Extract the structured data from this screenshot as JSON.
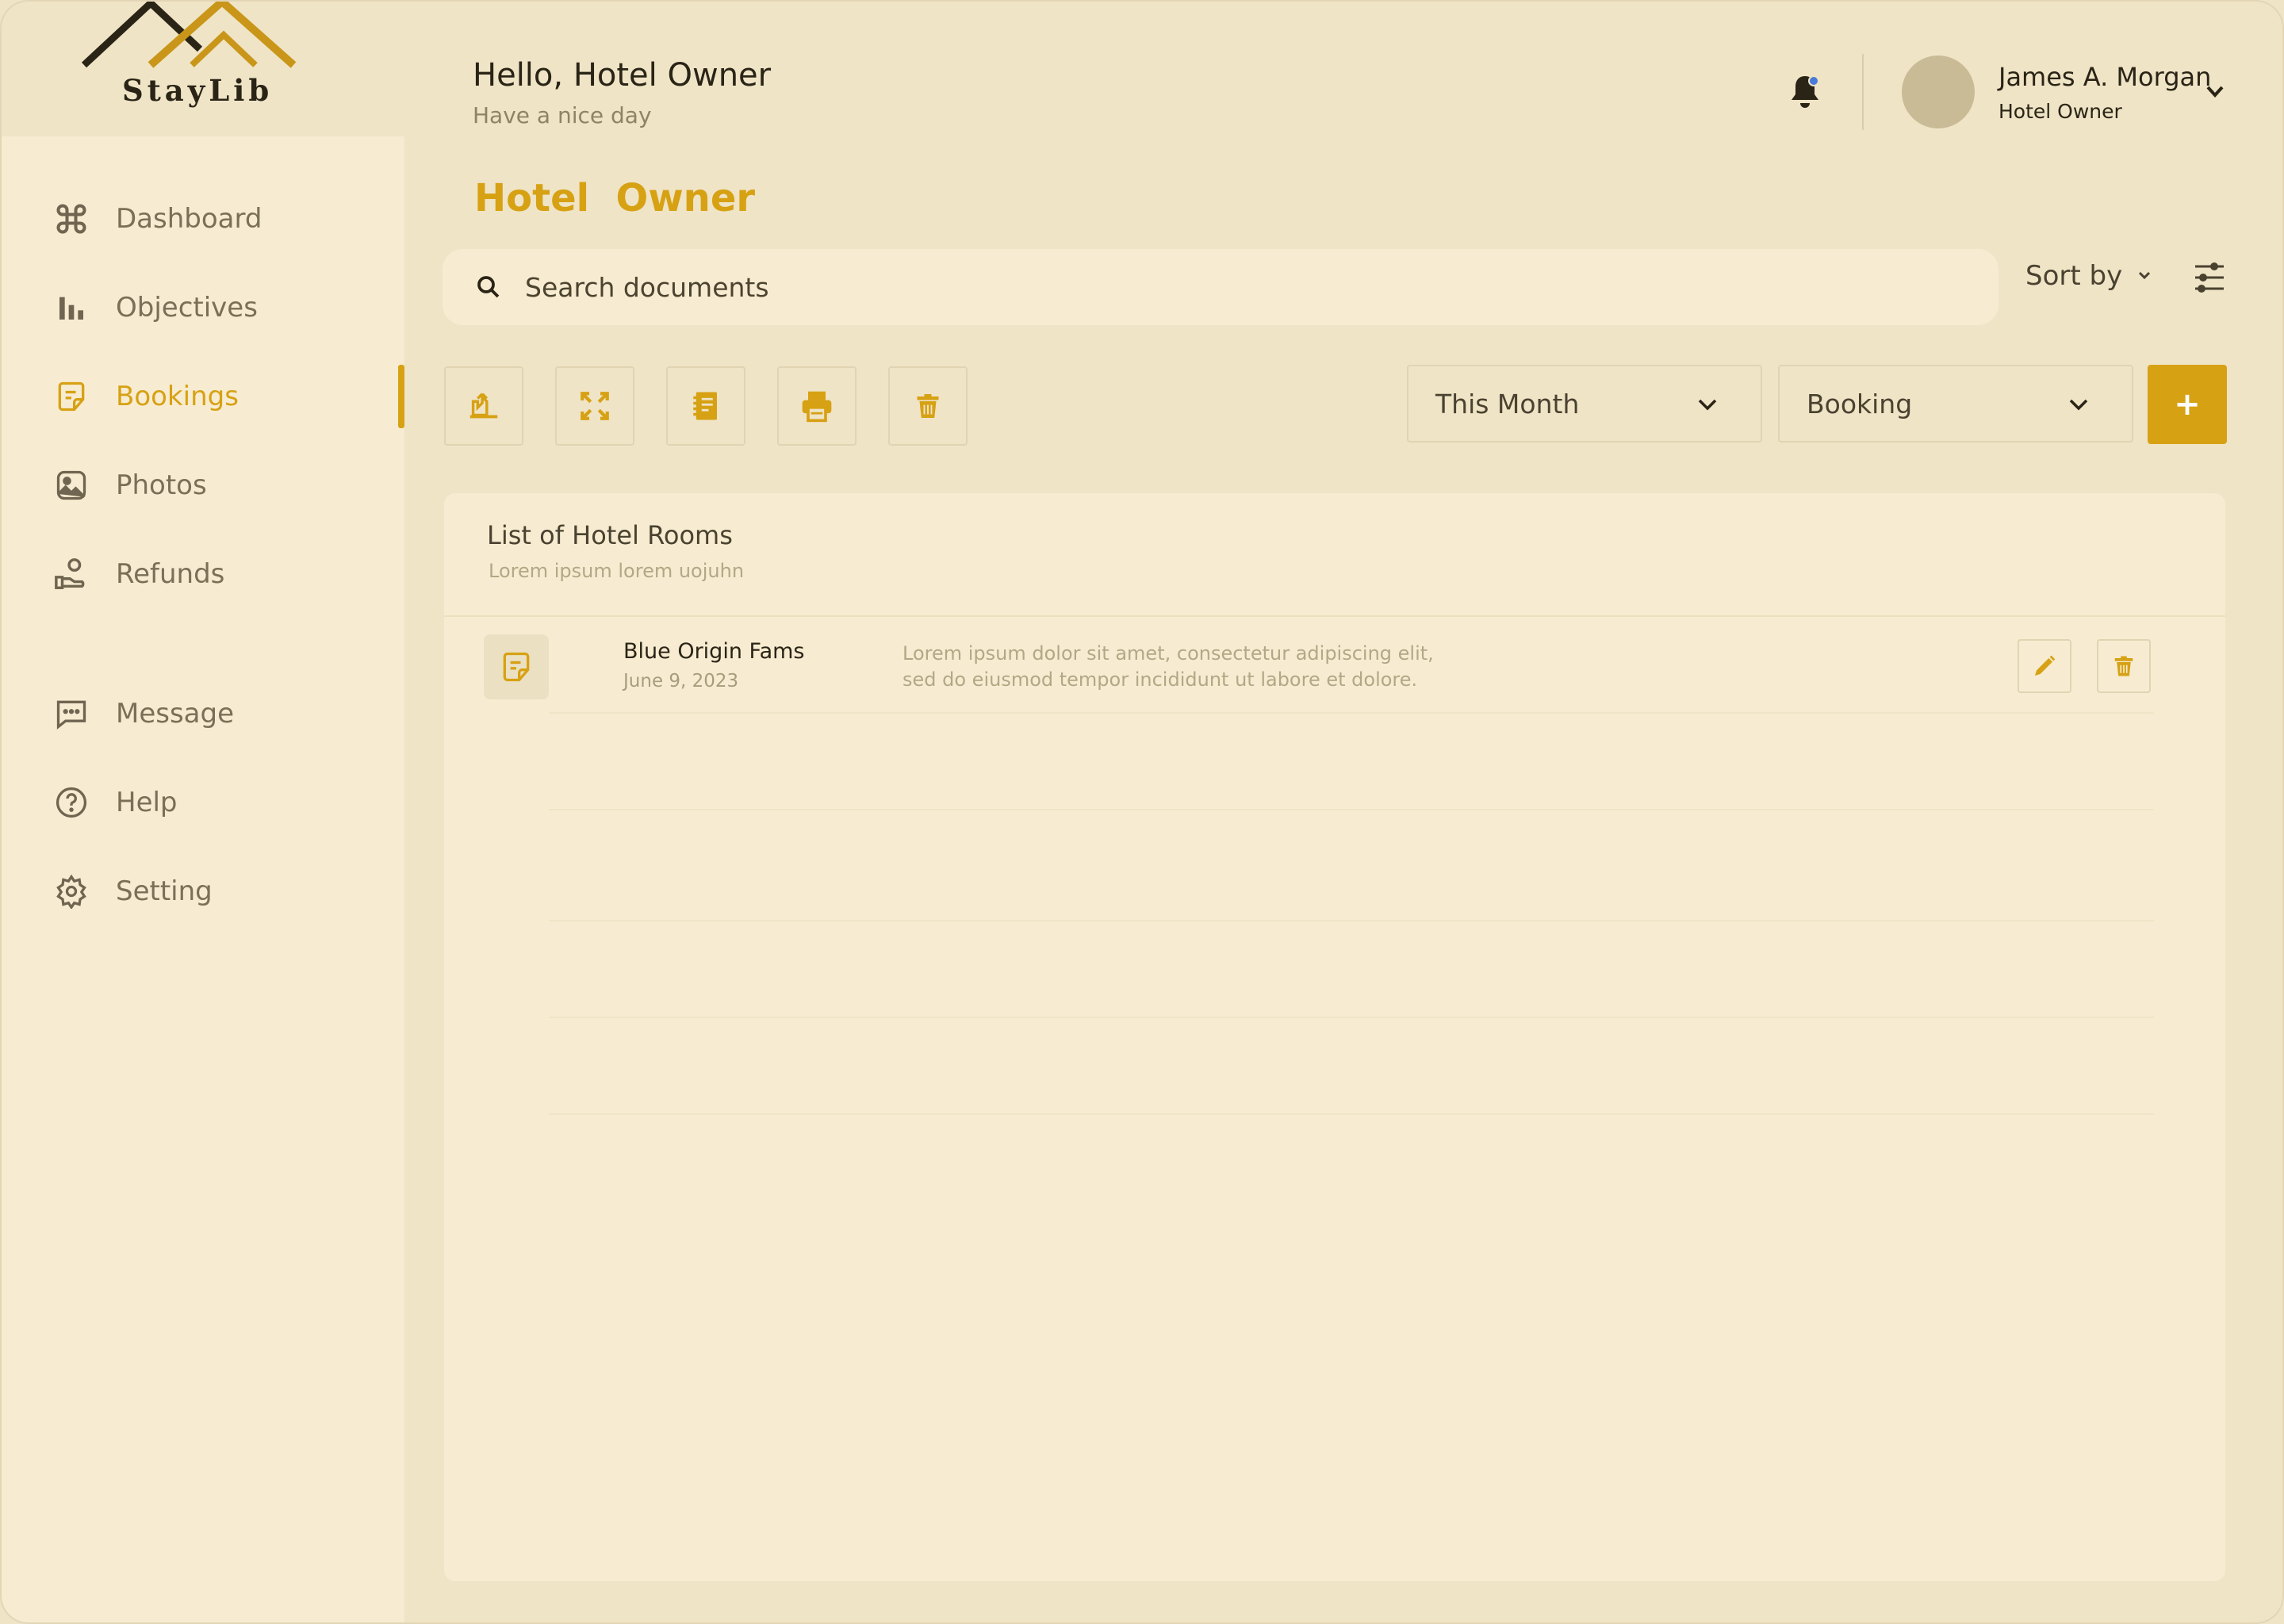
{
  "brand": {
    "name": "StayLib"
  },
  "sidebar": {
    "items": [
      {
        "label": "Dashboard",
        "icon": "command-icon",
        "active": false
      },
      {
        "label": "Objectives",
        "icon": "bar-chart-icon",
        "active": false
      },
      {
        "label": "Bookings",
        "icon": "document-icon",
        "active": true
      },
      {
        "label": "Photos",
        "icon": "image-icon",
        "active": false
      },
      {
        "label": "Refunds",
        "icon": "hand-money-icon",
        "active": false
      },
      {
        "label": "Message",
        "icon": "message-icon",
        "active": false
      },
      {
        "label": "Help",
        "icon": "help-circle-icon",
        "active": false
      },
      {
        "label": "Setting",
        "icon": "gear-icon",
        "active": false
      }
    ]
  },
  "header": {
    "greeting": "Hello, Hotel Owner",
    "subgreeting": "Have a nice day",
    "user_name": "James A. Morgan",
    "user_role": "Hotel Owner"
  },
  "page": {
    "title": "Hotel  Owner"
  },
  "search": {
    "placeholder": "Search documents",
    "value": ""
  },
  "sort": {
    "label": "Sort by"
  },
  "filters": {
    "period": "This Month",
    "type": "Booking",
    "add_label": "+"
  },
  "card": {
    "title": "List of Hotel Rooms",
    "subtitle": "Lorem ipsum lorem uojuhn",
    "rows": [
      {
        "name": "Blue Origin Fams",
        "date": "June 9, 2023",
        "description": "Lorem ipsum dolor sit amet, consectetur adipiscing elit, sed do eiusmod tempor incididunt ut labore et dolore."
      }
    ]
  },
  "colors": {
    "accent": "#d7a114",
    "background": "#efe4c6",
    "panel": "#f7ecd1",
    "notification_dot": "#4a7bd9"
  }
}
